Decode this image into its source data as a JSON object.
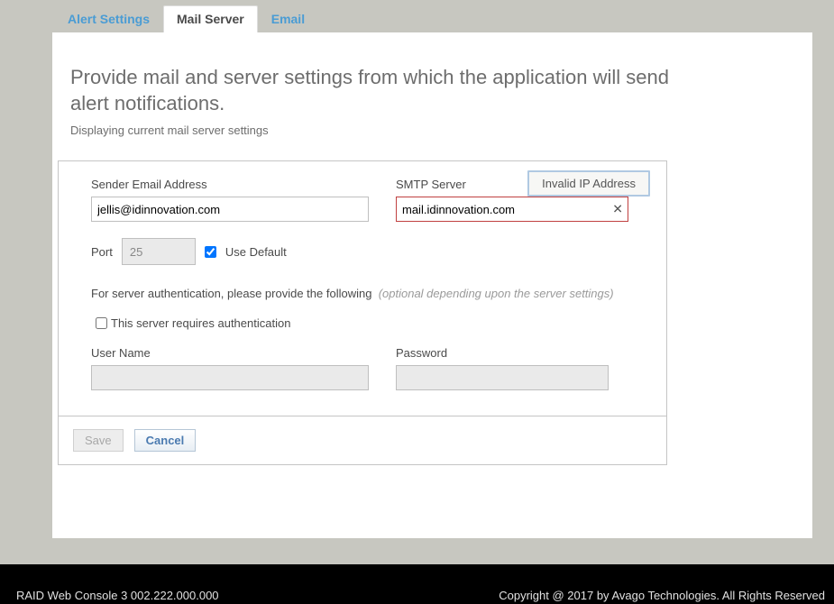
{
  "tabs": {
    "alert_settings": "Alert Settings",
    "mail_server": "Mail Server",
    "email": "Email"
  },
  "header": {
    "title": "Provide mail and server settings from which the application will send alert notifications.",
    "subtitle": "Displaying current mail server settings"
  },
  "tooltip": {
    "text": "Invalid IP Address"
  },
  "form": {
    "sender_label": "Sender Email Address",
    "sender_value": "jellis@idinnovation.com",
    "smtp_label": "SMTP Server",
    "smtp_value": "mail.idinnovation.com",
    "clear_glyph": "✕",
    "port_label": "Port",
    "port_value": "25",
    "use_default_label": "Use Default",
    "use_default_checked": true,
    "auth_prompt": "For server authentication, please provide the following",
    "auth_optional": "(optional depending upon the server settings)",
    "requires_auth_label": "This server requires authentication",
    "requires_auth_checked": false,
    "username_label": "User Name",
    "username_value": "",
    "password_label": "Password",
    "password_value": ""
  },
  "buttons": {
    "save": "Save",
    "cancel": "Cancel"
  },
  "footer": {
    "left": "RAID Web Console 3   002.222.000.000",
    "right": "Copyright @ 2017 by Avago Technologies. All Rights Reserved"
  }
}
